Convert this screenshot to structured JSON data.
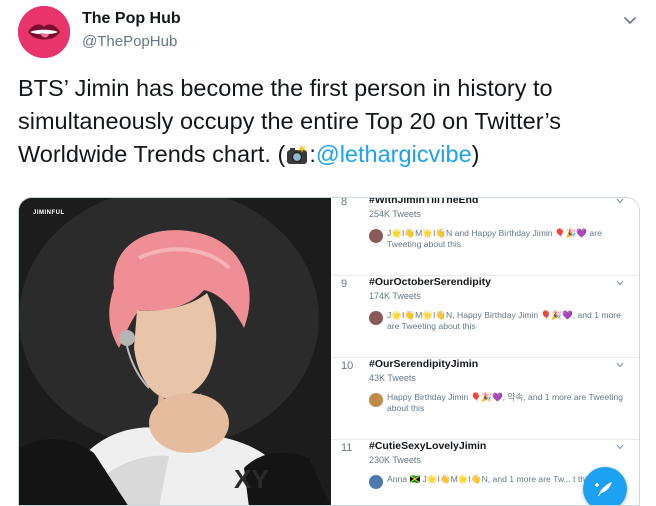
{
  "account": {
    "name": "The Pop Hub",
    "handle": "@ThePopHub",
    "avatar_icon": "lips-icon",
    "avatar_color": "#e8336b"
  },
  "tweet": {
    "text_main": "BTS’ Jimin has become the first person in history to simultaneously occupy the entire Top 20 on Twitter’s Worldwide Trends chart. (",
    "camera_icon": "camera-flash-emoji",
    "text_colon": ":",
    "mention": "@lethargicvibe",
    "text_end": ")",
    "link_color": "#1da1f2"
  },
  "media": {
    "watermark": "JIMINFUL",
    "trends": [
      {
        "rank": "8",
        "tag": "#WithJiminTillTheEnd",
        "count": "254K Tweets",
        "context": "J🌟I👋M🌟I👋N and Happy Birthday Jimin 🎈🎉💜 are Tweeting about this"
      },
      {
        "rank": "9",
        "tag": "#OurOctoberSerendipity",
        "count": "174K Tweets",
        "context": "J🌟I👋M🌟I👋N, Happy Birthday Jimin 🎈🎉💜, and 1 more are Tweeting about this"
      },
      {
        "rank": "10",
        "tag": "#OurSerendipityJimin",
        "count": "43K Tweets",
        "context": "Happy Birthday Jimin 🎈🎉💜, 약속, and 1 more are Tweeting about this"
      },
      {
        "rank": "11",
        "tag": "#CutieSexyLovelyJimin",
        "count": "230K Tweets",
        "context": "Anna 🇯🇲 J🌟I👋M🌟I👋N, and 1 more are Tw... t this"
      }
    ],
    "compose_icon": "compose-feather-icon"
  }
}
